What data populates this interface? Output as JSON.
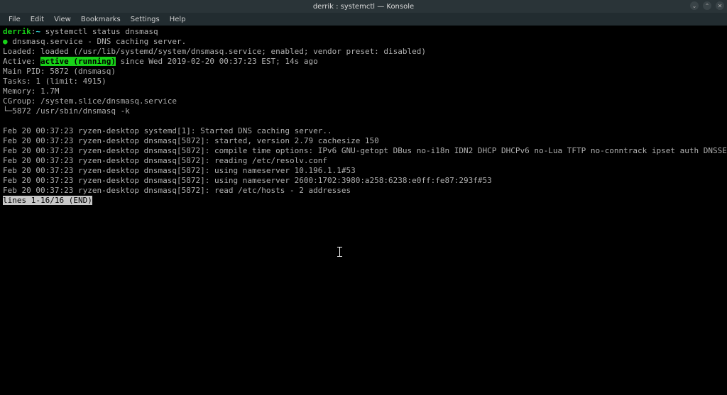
{
  "titlebar": {
    "title": "derrik : systemctl — Konsole"
  },
  "winbtns": {
    "min": "⌄",
    "max": "⌃",
    "close": "✕"
  },
  "menu": {
    "file": "File",
    "edit": "Edit",
    "view": "View",
    "bookmarks": "Bookmarks",
    "settings": "Settings",
    "help": "Help"
  },
  "prompt": {
    "user": "derrik",
    "sep1": ":",
    "path": "~",
    "cmd": "systemctl status dnsmasq"
  },
  "svc": {
    "bullet": "●",
    "name": "dnsmasq.service - DNS caching server.",
    "loaded_lbl": "   Loaded: ",
    "loaded_val": "loaded (/usr/lib/systemd/system/dnsmasq.service; enabled; vendor preset: disabled)",
    "active_lbl": "   Active: ",
    "active_val": "active (running)",
    "active_tail": " since Wed 2019-02-20 00:37:23 EST; 14s ago",
    "mainpid": " Main PID: 5872 (dnsmasq)",
    "tasks": "    Tasks: 1 (limit: 4915)",
    "memory": "   Memory: 1.7M",
    "cgroup1": "   CGroup: /system.slice/dnsmasq.service",
    "cgroup2": "           └─5872 /usr/sbin/dnsmasq -k"
  },
  "log": {
    "l1": "Feb 20 00:37:23 ryzen-desktop systemd[1]: Started DNS caching server..",
    "l2": "Feb 20 00:37:23 ryzen-desktop dnsmasq[5872]: started, version 2.79 cachesize 150",
    "l3": "Feb 20 00:37:23 ryzen-desktop dnsmasq[5872]: compile time options: IPv6 GNU-getopt DBus no-i18n IDN2 DHCP DHCPv6 no-Lua TFTP no-conntrack ipset auth DNSSEC loop-detect inot",
    "l4": "Feb 20 00:37:23 ryzen-desktop dnsmasq[5872]: reading /etc/resolv.conf",
    "l5": "Feb 20 00:37:23 ryzen-desktop dnsmasq[5872]: using nameserver 10.196.1.1#53",
    "l6": "Feb 20 00:37:23 ryzen-desktop dnsmasq[5872]: using nameserver 2600:1702:3980:a258:6238:e0ff:fe87:293f#53",
    "l7": "Feb 20 00:37:23 ryzen-desktop dnsmasq[5872]: read /etc/hosts - 2 addresses"
  },
  "pager": {
    "status": "lines 1-16/16 (END)"
  }
}
